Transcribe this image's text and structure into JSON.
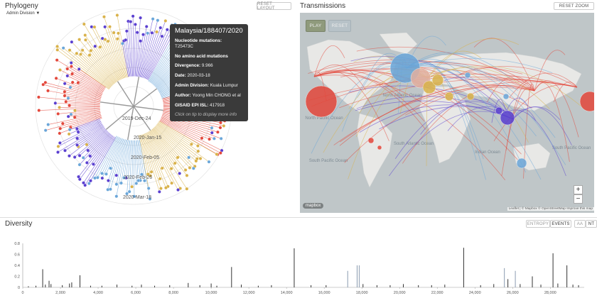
{
  "phylogeny": {
    "title": "Phylogeny",
    "color_by": "Admin Division",
    "reset_layout": "RESET LAYOUT",
    "date_labels": [
      "2019-Dec-24",
      "2020-Jan-15",
      "2020-Feb-05",
      "2020-Feb-26",
      "2020-Mar-18"
    ],
    "tooltip": {
      "strain": "Malaysia/188407/2020",
      "nuc_label": "Nucleotide mutations:",
      "nuc_value": "T25473C",
      "aa": "No amino acid mutations",
      "div_label": "Divergence:",
      "div_value": "9.966",
      "date_label": "Date:",
      "date_value": "2020-03-18",
      "admin_label": "Admin Division:",
      "admin_value": "Kuala Lumpur",
      "author_label": "Author:",
      "author_value": "Yoong Min CHONG et al",
      "gisaid_label": "GISAID EPI ISL:",
      "gisaid_value": "417918",
      "hint": "Click on tip to display more info"
    }
  },
  "transmissions": {
    "title": "Transmissions",
    "reset_zoom": "RESET ZOOM",
    "play": "PLAY",
    "reset": "RESET",
    "zoom_in": "+",
    "zoom_out": "−",
    "logo": "mapbox",
    "attribution": "Leaflet | © Mapbox © OpenStreetMap Improve this map",
    "ocean_labels": [
      "North Pacific Ocean",
      "North Atlantic Ocean",
      "South Pacific Ocean",
      "South Atlantic Ocean",
      "Indian Ocean",
      "South Pacific Ocean"
    ]
  },
  "diversity": {
    "title": "Diversity",
    "toggles": [
      "ENTROPY",
      "EVENTS",
      "AA",
      "NT"
    ],
    "active": [
      "EVENTS",
      "NT"
    ],
    "colors": {
      "bar": "#333333",
      "highlight": "#8a9bb0"
    }
  },
  "chart_data": {
    "type": "bar",
    "title": "",
    "xlabel": "",
    "ylabel": "",
    "xlim": [
      0,
      29800
    ],
    "ylim": [
      0,
      0.8
    ],
    "xticks": [
      "0",
      "2,000",
      "4,000",
      "6,000",
      "8,000",
      "10,000",
      "12,000",
      "14,000",
      "16,000",
      "18,000",
      "20,000",
      "22,000",
      "24,000",
      "26,000",
      "28,000"
    ],
    "yticks": [
      "0",
      "0.2",
      "0.4",
      "0.6",
      "0.8"
    ],
    "bars": [
      {
        "x": 300,
        "y": 0.02
      },
      {
        "x": 700,
        "y": 0.03
      },
      {
        "x": 1059,
        "y": 0.33
      },
      {
        "x": 1200,
        "y": 0.05
      },
      {
        "x": 1397,
        "y": 0.12
      },
      {
        "x": 1500,
        "y": 0.06
      },
      {
        "x": 2100,
        "y": 0.04
      },
      {
        "x": 2480,
        "y": 0.07
      },
      {
        "x": 2600,
        "y": 0.09
      },
      {
        "x": 3037,
        "y": 0.22
      },
      {
        "x": 3600,
        "y": 0.03
      },
      {
        "x": 4200,
        "y": 0.03
      },
      {
        "x": 5000,
        "y": 0.05
      },
      {
        "x": 5800,
        "y": 0.03
      },
      {
        "x": 6300,
        "y": 0.05
      },
      {
        "x": 7000,
        "y": 0.03
      },
      {
        "x": 7800,
        "y": 0.04
      },
      {
        "x": 8782,
        "y": 0.08
      },
      {
        "x": 9400,
        "y": 0.04
      },
      {
        "x": 10000,
        "y": 0.07
      },
      {
        "x": 10300,
        "y": 0.03
      },
      {
        "x": 11083,
        "y": 0.37
      },
      {
        "x": 11600,
        "y": 0.05
      },
      {
        "x": 12500,
        "y": 0.03
      },
      {
        "x": 13200,
        "y": 0.04
      },
      {
        "x": 14408,
        "y": 0.71
      },
      {
        "x": 15300,
        "y": 0.04
      },
      {
        "x": 16100,
        "y": 0.04
      },
      {
        "x": 17247,
        "y": 0.3
      },
      {
        "x": 17747,
        "y": 0.4
      },
      {
        "x": 17858,
        "y": 0.4
      },
      {
        "x": 18060,
        "y": 0.06
      },
      {
        "x": 18800,
        "y": 0.04
      },
      {
        "x": 19500,
        "y": 0.04
      },
      {
        "x": 20200,
        "y": 0.06
      },
      {
        "x": 21000,
        "y": 0.04
      },
      {
        "x": 21700,
        "y": 0.04
      },
      {
        "x": 22400,
        "y": 0.05
      },
      {
        "x": 23403,
        "y": 0.72
      },
      {
        "x": 24300,
        "y": 0.04
      },
      {
        "x": 25000,
        "y": 0.06
      },
      {
        "x": 25563,
        "y": 0.35
      },
      {
        "x": 25750,
        "y": 0.15
      },
      {
        "x": 26144,
        "y": 0.3
      },
      {
        "x": 26400,
        "y": 0.06
      },
      {
        "x": 27046,
        "y": 0.2
      },
      {
        "x": 27500,
        "y": 0.05
      },
      {
        "x": 28144,
        "y": 0.62
      },
      {
        "x": 28400,
        "y": 0.07
      },
      {
        "x": 28881,
        "y": 0.4
      },
      {
        "x": 29200,
        "y": 0.05
      },
      {
        "x": 29500,
        "y": 0.04
      }
    ]
  }
}
